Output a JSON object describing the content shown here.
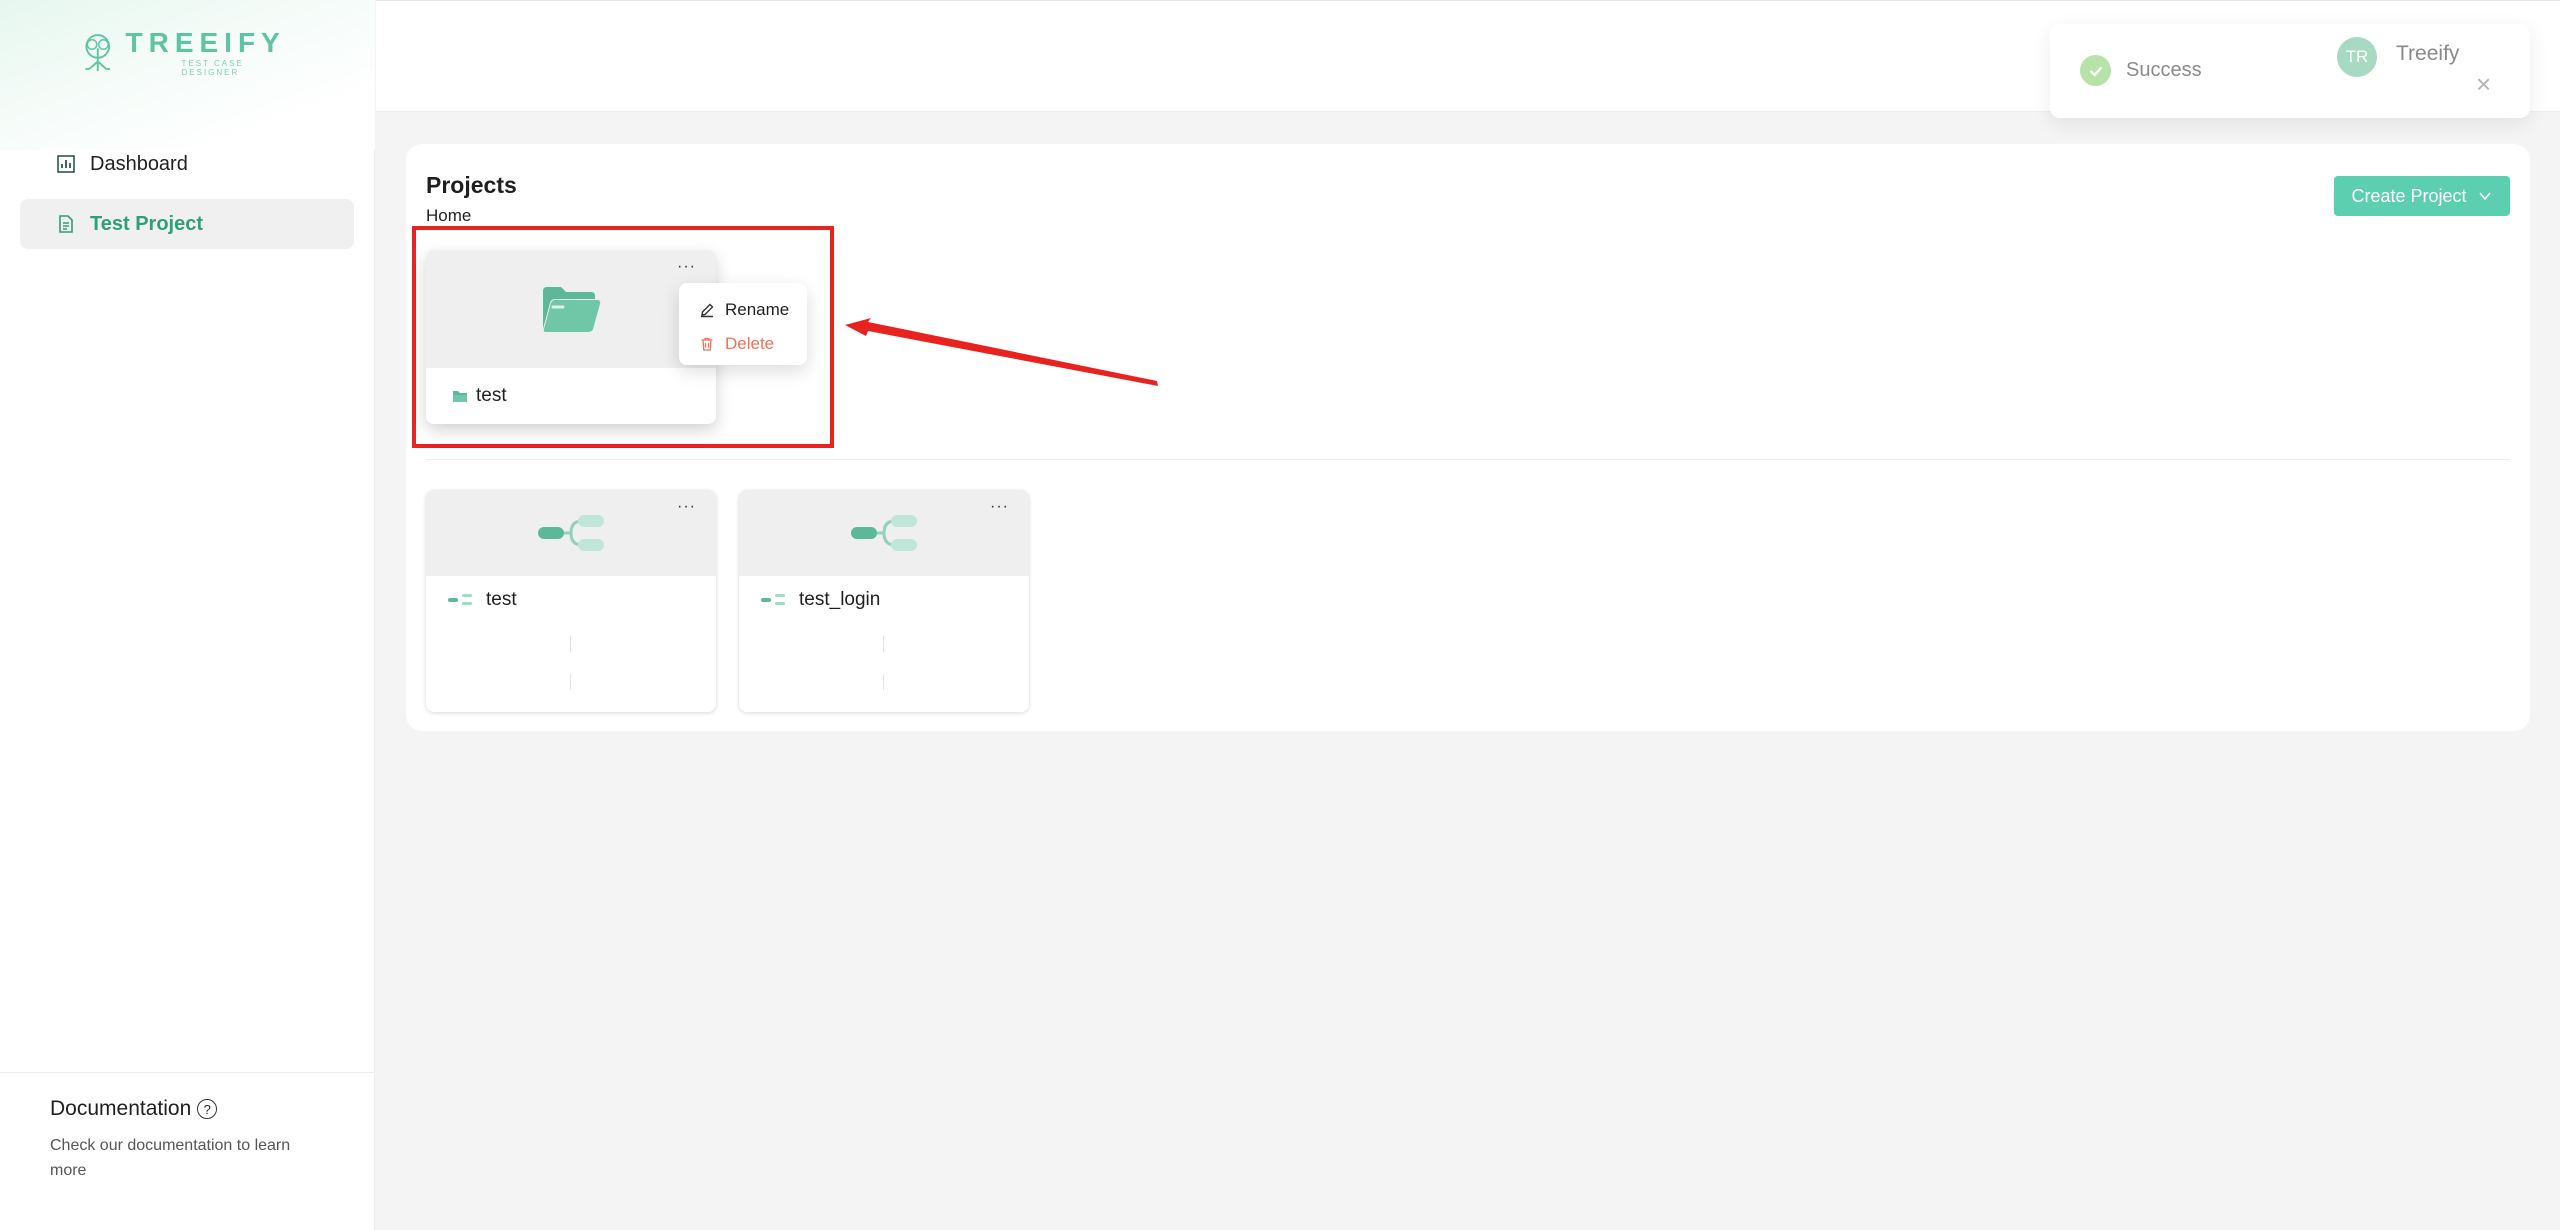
{
  "app": {
    "logo_title": "TREEIFY",
    "logo_subtitle": "TEST CASE DESIGNER",
    "brand_color": "#5fc4a3"
  },
  "sidebar": {
    "items": [
      {
        "label": "Dashboard",
        "icon": "bar-chart-icon",
        "active": false
      },
      {
        "label": "Test Project",
        "icon": "document-icon",
        "active": true
      }
    ],
    "documentation": {
      "title": "Documentation",
      "description": "Check our documentation to learn more"
    }
  },
  "toast": {
    "message": "Success",
    "avatar_initials": "TR",
    "user_name": "Treeify",
    "close_icon": "close-icon"
  },
  "main": {
    "title": "Projects",
    "breadcrumb": "Home",
    "create_button": "Create Project",
    "folders": [
      {
        "name": "test",
        "icon": "folder-icon"
      }
    ],
    "context_menu": {
      "rename": "Rename",
      "delete": "Delete"
    },
    "mindmaps": [
      {
        "name": "test",
        "icon": "mindmap-icon"
      },
      {
        "name": "test_login",
        "icon": "mindmap-icon"
      }
    ],
    "more_label": "···"
  },
  "annotation": {
    "color": "#e8231f"
  }
}
